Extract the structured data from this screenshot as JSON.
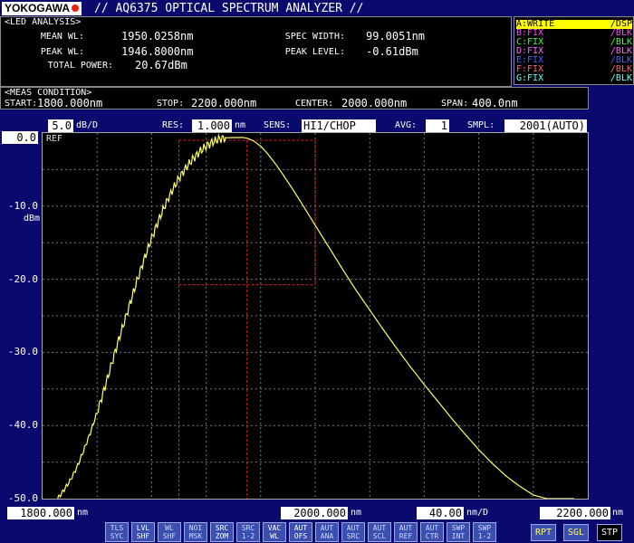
{
  "header": {
    "brand": "YOKOGAWA",
    "title": "// AQ6375 OPTICAL SPECTRUM ANALYZER //"
  },
  "led_analysis": {
    "heading": "<LED ANALYSIS>",
    "mean_wl_label": "MEAN WL:",
    "mean_wl": "1950.0258nm",
    "peak_wl_label": "PEAK WL:",
    "peak_wl": "1946.8000nm",
    "total_power_label": "TOTAL POWER:",
    "total_power": "20.67dBm",
    "spec_width_label": "SPEC WIDTH:",
    "spec_width": "99.0051nm",
    "peak_level_label": "PEAK LEVEL:",
    "peak_level": "-0.61dBm"
  },
  "traces": [
    {
      "name": "A:WRITE",
      "mode": "/DSP",
      "color": "#ffff00",
      "active": true
    },
    {
      "name": "B:FIX",
      "mode": "/BLK",
      "color": "#ff44ff",
      "active": false
    },
    {
      "name": "C:FIX",
      "mode": "/BLK",
      "color": "#44ff44",
      "active": false
    },
    {
      "name": "D:FIX",
      "mode": "/BLK",
      "color": "#ff66ff",
      "active": false
    },
    {
      "name": "E:FIX",
      "mode": "/BLK",
      "color": "#4466ff",
      "active": false
    },
    {
      "name": "F:FIX",
      "mode": "/BLK",
      "color": "#ff6666",
      "active": false
    },
    {
      "name": "G:FIX",
      "mode": "/BLK",
      "color": "#66ffff",
      "active": false
    }
  ],
  "meas_condition": {
    "heading": "<MEAS CONDITION>",
    "start_label": "START:",
    "start": "1800.000nm",
    "stop_label": "STOP:",
    "stop": "2200.000nm",
    "center_label": "CENTER:",
    "center": "2000.000nm",
    "span_label": "SPAN:",
    "span": "400.0nm"
  },
  "settings": {
    "scale_value": "5.0",
    "scale_unit": "dB/D",
    "res_label": "RES:",
    "res_value": "1.000",
    "res_unit": "nm",
    "sens_label": "SENS:",
    "sens_value": "HI1/CHOP",
    "avg_label": "AVG:",
    "avg_value": "1",
    "smpl_label": "SMPL:",
    "smpl_value": "2001(AUTO)",
    "ref_level": "0.0",
    "ref_label": "REF",
    "y_unit": "dBm"
  },
  "bottom_scale": {
    "start": "1800.000",
    "start_unit": "nm",
    "center": "2000.000",
    "center_unit": "nm",
    "per_div": "40.00",
    "per_div_unit": "nm/D",
    "stop": "2200.000",
    "stop_unit": "nm"
  },
  "function_buttons": [
    {
      "line1": "TLS",
      "line2": "SYC",
      "lit": false
    },
    {
      "line1": "LVL",
      "line2": "SHF",
      "lit": true
    },
    {
      "line1": "WL",
      "line2": "SHF",
      "lit": false
    },
    {
      "line1": "NOI",
      "line2": "MSK",
      "lit": false
    },
    {
      "line1": "SRC",
      "line2": "ZOM",
      "lit": true
    },
    {
      "line1": "SRC",
      "line2": "1-2",
      "lit": false
    },
    {
      "line1": "VAC",
      "line2": "WL",
      "lit": true
    },
    {
      "line1": "AUT",
      "line2": "OFS",
      "lit": true
    },
    {
      "line1": "AUT",
      "line2": "ANA",
      "lit": false
    },
    {
      "line1": "AUT",
      "line2": "SRC",
      "lit": false
    },
    {
      "line1": "AUT",
      "line2": "SCL",
      "lit": false
    },
    {
      "line1": "AUT",
      "line2": "REF",
      "lit": false
    },
    {
      "line1": "AUT",
      "line2": "CTR",
      "lit": false
    },
    {
      "line1": "SWP",
      "line2": "INT",
      "lit": false
    },
    {
      "line1": "SWP",
      "line2": "1-2",
      "lit": false
    }
  ],
  "sweep_buttons": [
    "RPT",
    "SGL",
    "STP"
  ],
  "chart_data": {
    "type": "line",
    "xlim": [
      1800,
      2200
    ],
    "ylim": [
      -50,
      0
    ],
    "y_tick_labels": [
      "0.0",
      "-10.0",
      "-20.0",
      "-30.0",
      "-40.0",
      "-50.0"
    ],
    "grid": true,
    "series": [
      {
        "color": "#ffff66",
        "x": [
          1811,
          1815,
          1820,
          1825,
          1830,
          1835,
          1840,
          1845,
          1850,
          1855,
          1860,
          1865,
          1870,
          1875,
          1880,
          1885,
          1890,
          1895,
          1900,
          1905,
          1910,
          1915,
          1920,
          1925,
          1930,
          1935,
          1940,
          1946.8,
          1950,
          1955,
          1960,
          1965,
          1970,
          1975,
          1980,
          1985,
          1990,
          1995,
          2000,
          2010,
          2020,
          2030,
          2040,
          2050,
          2060,
          2070,
          2080,
          2090,
          2100,
          2110,
          2120,
          2130,
          2140,
          2150,
          2160,
          2170,
          2180,
          2190
        ],
        "y": [
          -50.0,
          -49.0,
          -47.6,
          -45.8,
          -43.5,
          -41.0,
          -38.2,
          -35.2,
          -32.0,
          -28.8,
          -25.8,
          -22.8,
          -19.8,
          -17.0,
          -14.4,
          -12.0,
          -9.8,
          -7.9,
          -6.2,
          -4.8,
          -3.6,
          -2.6,
          -1.8,
          -1.2,
          -0.8,
          -0.65,
          -0.62,
          -0.61,
          -0.7,
          -1.1,
          -1.8,
          -2.8,
          -4.0,
          -5.3,
          -6.7,
          -8.1,
          -9.6,
          -11.1,
          -12.6,
          -15.6,
          -18.6,
          -21.5,
          -24.2,
          -26.9,
          -29.5,
          -32.0,
          -34.4,
          -36.7,
          -39.0,
          -41.2,
          -43.3,
          -45.2,
          -46.9,
          -48.3,
          -49.5,
          -50.0,
          -50.0,
          -50.0
        ]
      }
    ],
    "analysis_box": {
      "x1": 1950.0258,
      "x2": 2000,
      "x_left_outer": 1900,
      "y_top": 0,
      "y_bottom": -20.0
    }
  }
}
